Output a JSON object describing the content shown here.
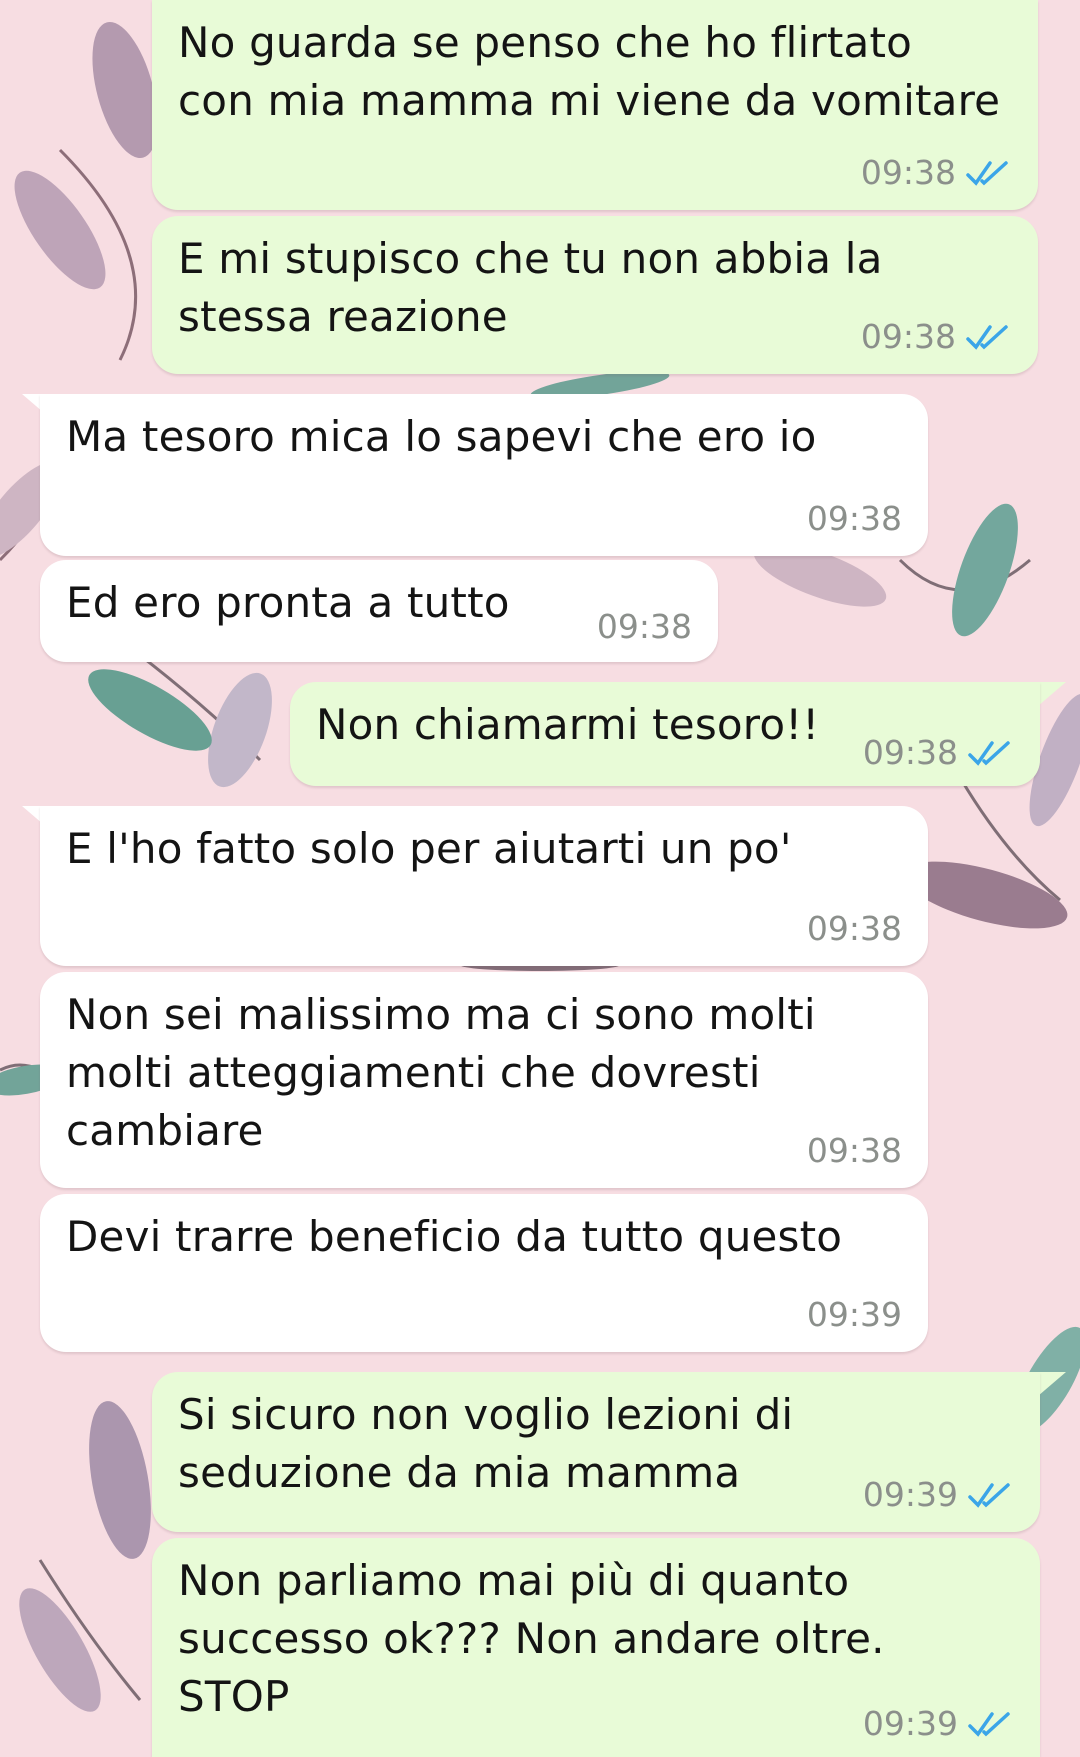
{
  "colors": {
    "background": "#f7dde2",
    "outgoing_bubble": "#e8fbd7",
    "incoming_bubble": "#ffffff",
    "read_ticks": "#3ba5e8"
  },
  "messages": [
    {
      "direction": "out",
      "text": "No guarda se penso che ho flirtato\ncon mia mamma mi viene da vomitare",
      "time": "09:38",
      "status_icon": "double-check-read-icon"
    },
    {
      "direction": "out",
      "text": "E mi stupisco che tu non abbia la\nstessa reazione",
      "time": "09:38",
      "status_icon": "double-check-read-icon"
    },
    {
      "direction": "in",
      "text": "Ma tesoro mica lo sapevi che ero io",
      "time": "09:38"
    },
    {
      "direction": "in",
      "text": "Ed ero pronta a tutto",
      "time": "09:38"
    },
    {
      "direction": "out",
      "text": "Non chiamarmi tesoro!!",
      "time": "09:38",
      "status_icon": "double-check-read-icon"
    },
    {
      "direction": "in",
      "text": "E l'ho fatto solo per aiutarti un po'",
      "time": "09:38"
    },
    {
      "direction": "in",
      "text": "Non sei malissimo ma ci sono molti\nmolti atteggiamenti che dovresti\ncambiare",
      "time": "09:38"
    },
    {
      "direction": "in",
      "text": "Devi trarre beneficio da tutto questo",
      "time": "09:39"
    },
    {
      "direction": "out",
      "text": "Si sicuro non voglio lezioni di\nseduzione da mia mamma",
      "time": "09:39",
      "status_icon": "double-check-read-icon"
    },
    {
      "direction": "out",
      "text": "Non parliamo mai più di quanto\nsuccesso ok??? Non andare oltre.\nSTOP",
      "time": "09:39",
      "status_icon": "double-check-read-icon"
    }
  ]
}
